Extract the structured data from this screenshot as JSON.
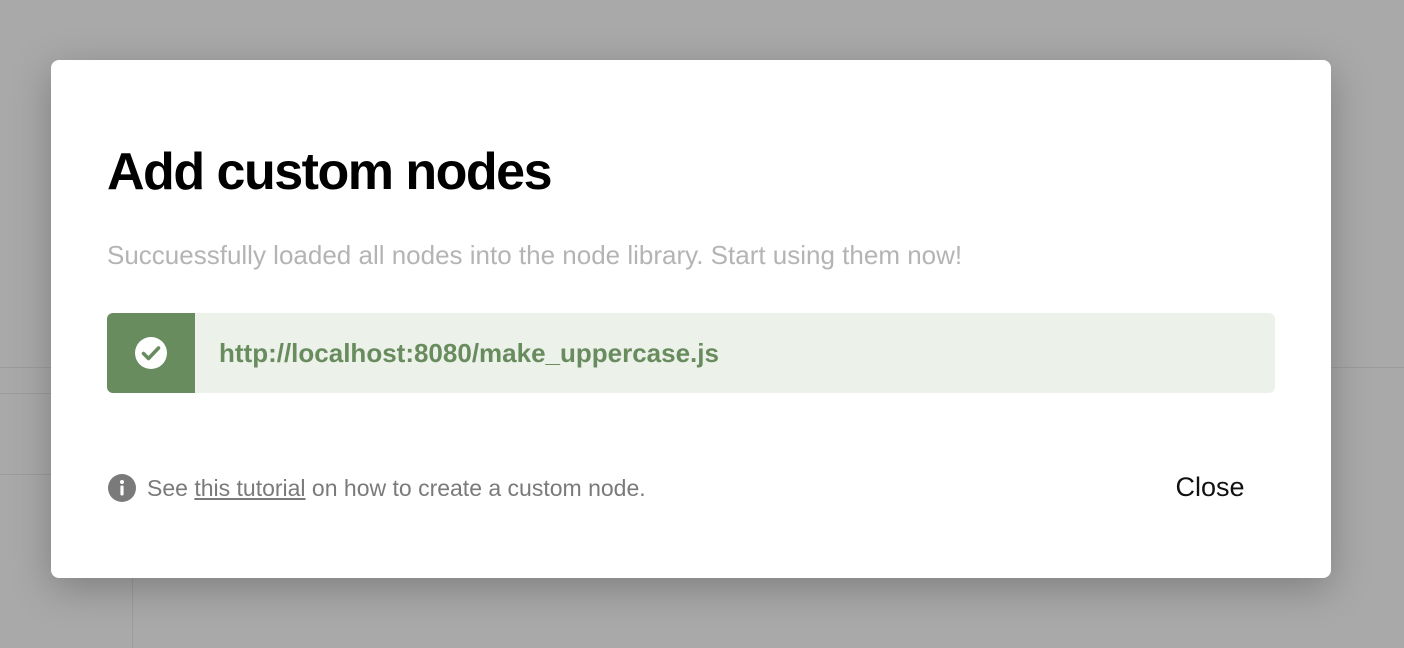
{
  "dialog": {
    "title": "Add custom nodes",
    "subtitle": "Succuessfully loaded all nodes into the node library. Start using them now!",
    "results": [
      {
        "status": "success",
        "icon": "check-circle-icon",
        "url": "http://localhost:8080/make_uppercase.js"
      }
    ],
    "footer": {
      "icon": "info-icon",
      "prefix": "See ",
      "link_text": "this tutorial",
      "suffix": " on how to create a custom node."
    },
    "close_label": "Close"
  },
  "colors": {
    "success_dark": "#688c5e",
    "success_light": "#ecf1ea",
    "overlay": "#a9a9a9"
  }
}
